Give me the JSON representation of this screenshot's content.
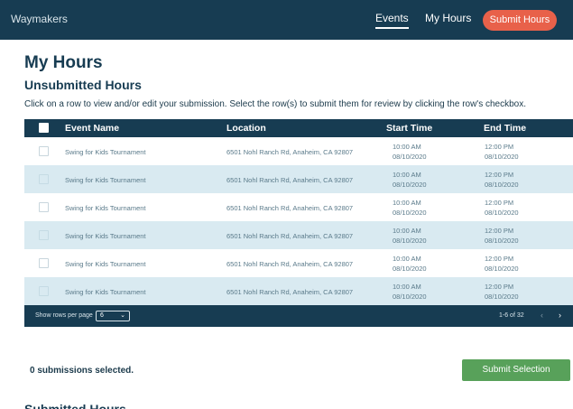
{
  "nav": {
    "brand": "Waymakers",
    "events_label": "Events",
    "my_hours_label": "My Hours",
    "submit_hours_label": "Submit Hours"
  },
  "page": {
    "title": "My Hours",
    "unsubmitted_title": "Unsubmitted Hours",
    "instructions": "Click on a row to view and/or edit your submission. Select the row(s) to submit them for review by clicking the row's checkbox.",
    "submitted_title": "Submitted Hours"
  },
  "table": {
    "headers": {
      "event_name": "Event Name",
      "location": "Location",
      "start_time": "Start Time",
      "end_time": "End Time"
    },
    "rows": [
      {
        "event": "Swing for Kids Tournament",
        "location": "6501 Nohl Ranch Rd, Anaheim, CA 92807",
        "start_time": "10:00 AM",
        "start_date": "08/10/2020",
        "end_time": "12:00 PM",
        "end_date": "08/10/2020"
      },
      {
        "event": "Swing for Kids Tournament",
        "location": "6501 Nohl Ranch Rd, Anaheim, CA 92807",
        "start_time": "10:00 AM",
        "start_date": "08/10/2020",
        "end_time": "12:00 PM",
        "end_date": "08/10/2020"
      },
      {
        "event": "Swing for Kids Tournament",
        "location": "6501 Nohl Ranch Rd, Anaheim, CA 92807",
        "start_time": "10:00 AM",
        "start_date": "08/10/2020",
        "end_time": "12:00 PM",
        "end_date": "08/10/2020"
      },
      {
        "event": "Swing for Kids Tournament",
        "location": "6501 Nohl Ranch Rd, Anaheim, CA 92807",
        "start_time": "10:00 AM",
        "start_date": "08/10/2020",
        "end_time": "12:00 PM",
        "end_date": "08/10/2020"
      },
      {
        "event": "Swing for Kids Tournament",
        "location": "6501 Nohl Ranch Rd, Anaheim, CA 92807",
        "start_time": "10:00 AM",
        "start_date": "08/10/2020",
        "end_time": "12:00 PM",
        "end_date": "08/10/2020"
      },
      {
        "event": "Swing for Kids Tournament",
        "location": "6501 Nohl Ranch Rd, Anaheim, CA 92807",
        "start_time": "10:00 AM",
        "start_date": "08/10/2020",
        "end_time": "12:00 PM",
        "end_date": "08/10/2020"
      }
    ],
    "footer": {
      "rows_per_page_label": "Show rows per page",
      "rows_per_page_value": "6",
      "range": "1-6 of 32"
    }
  },
  "selection": {
    "count_text": "0 submissions selected.",
    "submit_label": "Submit Selection"
  },
  "icons": {
    "prev": "chevron-left-icon",
    "next": "chevron-right-icon",
    "dropdown": "chevron-down-icon"
  },
  "colors": {
    "navy": "#173c52",
    "accent_orange": "#e8614a",
    "submit_green": "#58a15a",
    "row_stripe": "#d9eaf1"
  }
}
